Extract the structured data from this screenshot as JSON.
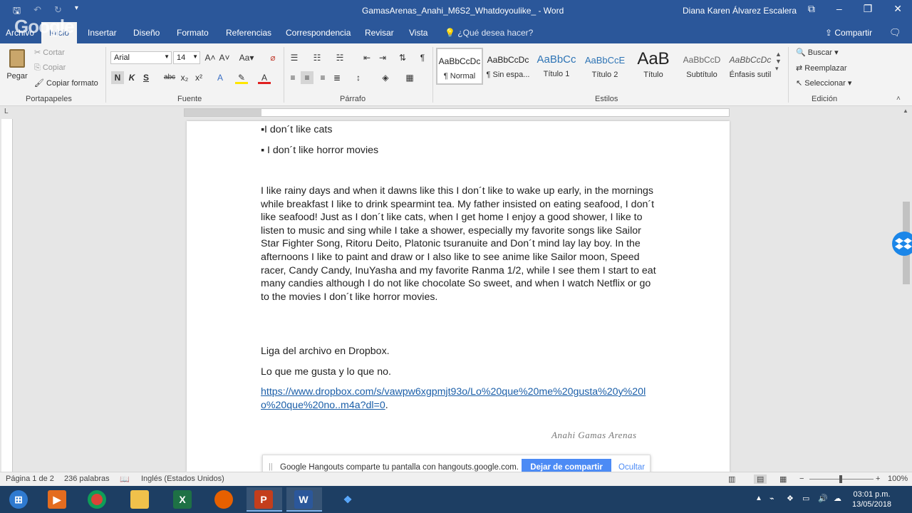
{
  "window": {
    "doc_title": "GamasArenas_Anahi_M6S2_Whatdoyoulike_ -  Word",
    "user_name": "Diana Karen Álvarez Escalera",
    "overlay_watermark": "Google"
  },
  "tabs": [
    "Archivo",
    "Inicio",
    "Insertar",
    "Diseño",
    "Formato",
    "Referencias",
    "Correspondencia",
    "Revisar",
    "Vista"
  ],
  "tell_me": "¿Qué desea hacer?",
  "share_label": "Compartir",
  "ribbon": {
    "clipboard": {
      "paste": "Pegar",
      "cut": "Cortar",
      "copy": "Copiar",
      "format_painter": "Copiar formato",
      "label": "Portapapeles"
    },
    "font": {
      "family": "Arial",
      "size": "14",
      "label": "Fuente",
      "bold": "N",
      "italic": "K",
      "underline": "S",
      "strike": "abc",
      "sub": "x₂",
      "sup": "x²"
    },
    "paragraph": {
      "label": "Párrafo"
    },
    "styles": {
      "label": "Estilos",
      "items": [
        {
          "preview": "AaBbCcDc",
          "name": "¶ Normal"
        },
        {
          "preview": "AaBbCcDc",
          "name": "¶ Sin espa..."
        },
        {
          "preview": "AaBbCc",
          "name": "Título 1"
        },
        {
          "preview": "AaBbCcE",
          "name": "Título 2"
        },
        {
          "preview": "AaB",
          "name": "Título"
        },
        {
          "preview": "AaBbCcD",
          "name": "Subtítulo"
        },
        {
          "preview": "AaBbCcDc",
          "name": "Énfasis sutil"
        }
      ]
    },
    "editing": {
      "find": "Buscar",
      "replace": "Reemplazar",
      "select": "Seleccionar",
      "label": "Edición"
    }
  },
  "document": {
    "bullets": [
      "▪I don´t like cats",
      "▪ I don´t like horror movies"
    ],
    "paragraph": "I like rainy days and when it dawns like this I don´t like to wake up early, in the mornings while breakfast I like to drink spearmint tea. My father insisted on eating seafood, I don´t like seafood! Just as I don´t like cats, when I get home I enjoy a good shower, I like to listen to music and sing while I take a shower, especially my favorite songs like Sailor Star Fighter Song, Ritoru Deito, Platonic tsuranuite and Don´t mind lay lay boy. In the afternoons I like to paint and draw or I also like to see anime like Sailor moon, Speed racer, Candy Candy, InuYasha and my favorite Ranma 1/2, while I see them I start to eat many candies although I do not like chocolate So sweet, and when I watch Netflix or go to the movies I don´t like horror movies.",
    "link_heading": "Liga del archivo en Dropbox.",
    "link_caption": "Lo que me gusta y lo que no.",
    "link_url": "https://www.dropbox.com/s/vawpw6xgpmjt93o/Lo%20que%20me%20gusta%20y%20lo%20que%20no..m4a?dl=0",
    "link_suffix": ".",
    "signature": "Anahi Gamas Arenas"
  },
  "hangouts": {
    "message": "Google Hangouts comparte tu pantalla con hangouts.google.com.",
    "stop_label": "Dejar de compartir",
    "hide_label": "Ocultar"
  },
  "status": {
    "page": "Página 1 de 2",
    "words": "236 palabras",
    "language": "Inglés (Estados Unidos)",
    "zoom": "100%"
  },
  "clock": {
    "time": "03:01 p.m.",
    "date": "13/05/2018"
  },
  "colors": {
    "word_blue": "#2b579a",
    "link": "#1a5ea8",
    "hangouts_blue": "#4c8bf5"
  }
}
